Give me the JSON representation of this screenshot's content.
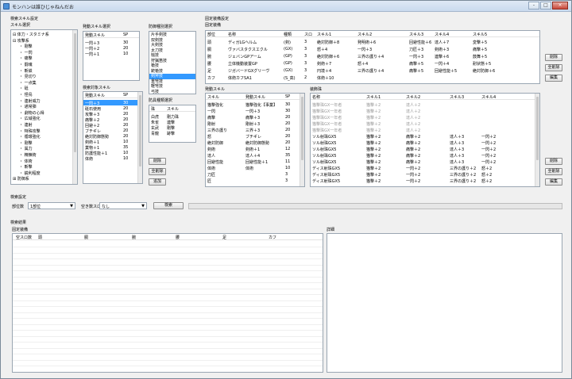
{
  "window": {
    "title": "モンハンは誰ひじゃねんだお",
    "min": "-",
    "max": "□",
    "close": "×"
  },
  "search": {
    "group_label": "検索スキル設定",
    "skill_select_label": "スキル選択",
    "tree": [
      "⊟ 体力・スタミナ系",
      "⊟ 攻撃系",
      "・ 剛撃",
      "・ 一閃",
      "・ 痛撃",
      "・ 闘魂",
      "・ 斬鉄",
      "・ 見切り",
      "・ 一点集",
      "・ 砥",
      "・ 怪鳥",
      "・ 連射威力",
      "・ 通常弾",
      "・ 劇物の心得",
      "・ 広域強化",
      "・ 連射",
      "・ 特殊攻撃",
      "・ 循環強化",
      "・ 剛撃",
      "・ 属力",
      "・ 精錬術",
      "・ 体術",
      "・ 斬撃",
      "・ 鋭利程度",
      "⊞ 防御系"
    ],
    "active_skill_label": "発動スキル選択",
    "active_skill_headers": [
      "発動スキル",
      "SP"
    ],
    "active_skills": [
      [
        "一閃＋3",
        "30"
      ],
      [
        "一閃＋2",
        "20"
      ],
      [
        "一閃＋1",
        "10"
      ]
    ],
    "target_label": "検索対象スキル",
    "target_headers": [
      "発動スキル",
      "SP"
    ],
    "targets": [
      [
        "一閃＋3",
        "30"
      ],
      [
        "砥石使用",
        "20"
      ],
      [
        "攻撃＋3",
        "20"
      ],
      [
        "痛撃＋2",
        "20"
      ],
      [
        "回避＋2",
        "20"
      ],
      [
        "ブチギレ",
        "20"
      ],
      [
        "絶対防御態勢",
        "20"
      ],
      [
        "剣術＋1",
        "10"
      ],
      [
        "業物＋1",
        "35"
      ],
      [
        "防護性能＋1",
        "10"
      ],
      [
        "体術",
        "10"
      ]
    ],
    "weapon_label": "防御種別選択",
    "weapons": [
      "片手剣技",
      "双剣技",
      "大剣技",
      "太刀技",
      "槌技",
      "狩猟笛技",
      "槍技",
      "銃槍技",
      "剣斧技",
      "重弩技",
      "軽弩技",
      "弓技"
    ],
    "weapon_selected": 8,
    "decor_label": "防具種類選択",
    "decor_headers": [
      "珠",
      "スキル"
    ],
    "decor_rows": [
      [
        "白虎",
        "剛力珠"
      ],
      [
        "朱雀",
        "連撃"
      ],
      [
        "玄武",
        "剛撃"
      ],
      [
        "青龍",
        "跡撃"
      ]
    ],
    "btn_delete": "削除",
    "btn_delete_all": "全削除",
    "btn_add": "追加"
  },
  "fixed": {
    "group_label": "固定装備設定",
    "equip_label": "固定装備",
    "headers": [
      "部位",
      "名称",
      "種類",
      "スロ",
      "スキル1",
      "スキル2",
      "スキル3",
      "スキル4",
      "スキル5"
    ],
    "rows": [
      [
        "頭",
        "ディガLGヘルム",
        "(剣)",
        "3",
        "絶対防御＋8",
        "発明術＋6",
        "回避性能＋6",
        "達人＋7",
        "変撃＋5"
      ],
      [
        "胴",
        "ヴァバスタクスエクル",
        "(GX)",
        "3",
        "怒＋4",
        "一閃＋3",
        "刀匠＋3",
        "剣術＋3",
        "痛撃＋5"
      ],
      [
        "腕",
        "ジェバンGPアーム",
        "(GP)",
        "3",
        "絶対防御＋6",
        "三界の護り＋4",
        "一閃＋3",
        "連撃＋6",
        "鼓舞＋5"
      ],
      [
        "腰",
        "立体機動装置GP",
        "(GP)",
        "3",
        "剣術＋7",
        "怒＋4",
        "痛撃＋5",
        "一閃＋4",
        "耐状態＋5"
      ],
      [
        "足",
        "ジガバードGXグリーヴ",
        "(GX)",
        "3",
        "円境＋4",
        "三界の護り＋4",
        "痛撃＋5",
        "回避性能＋5",
        "絶対防御＋6"
      ],
      [
        "カフ",
        "体術カフSA1",
        "(S_高)",
        "2",
        "体術＋10",
        "",
        "",
        "",
        ""
      ]
    ],
    "btn_delete": "削除",
    "btn_delete_all": "全削除",
    "btn_edit": "編集",
    "active_label": "発動スキル",
    "active_headers": [
      "スキル",
      "発動スキル",
      "SP"
    ],
    "active_rows": [
      [
        "猫撃強化",
        "猫撃強化【事業】",
        "30"
      ],
      [
        "一閃",
        "一閃＋3",
        "30"
      ],
      [
        "痛撃",
        "痛撃＋3",
        "20"
      ],
      [
        "剛射",
        "剛射＋3",
        "20"
      ],
      [
        "三界の護り",
        "三界＋3",
        "20"
      ],
      [
        "怒",
        "ブチギレ",
        "20"
      ],
      [
        "絶対防御",
        "絶対防御態勢",
        "20"
      ],
      [
        "剣術",
        "剣術＋1",
        "12"
      ],
      [
        "達人",
        "達人＋4",
        "35"
      ],
      [
        "回避性能",
        "回避性能＋1",
        "11"
      ],
      [
        "体術",
        "体術",
        "10"
      ],
      [
        "刀匠",
        "",
        "3"
      ],
      [
        "匠",
        "",
        "3"
      ]
    ],
    "decor_label": "装飾珠",
    "decor_headers": [
      "名称",
      "スキル1",
      "スキル2",
      "スキル3",
      "スキル4"
    ],
    "decor_rows": [
      [
        "猫撃珠GX一年者",
        "猫撃＋2",
        "達人＋2",
        "",
        ""
      ],
      [
        "猫撃珠GX一年者",
        "猫撃＋2",
        "達人＋2",
        "",
        ""
      ],
      [
        "猫撃珠GX一年者",
        "猫撃＋2",
        "達人＋2",
        "",
        ""
      ],
      [
        "猫撃珠GX一年者",
        "猫撃＋2",
        "達人＋2",
        "",
        ""
      ],
      [
        "猫撃珠GX一年者",
        "猫撃＋2",
        "達人＋2",
        "",
        ""
      ],
      [
        "ソル射珠GX5",
        "猫撃＋2",
        "痛撃＋2",
        "達人＋3",
        "一閃＋2"
      ],
      [
        "ソル射珠GX5",
        "猫撃＋2",
        "痛撃＋2",
        "達人＋3",
        "一閃＋2"
      ],
      [
        "ソル射珠GX5",
        "猫撃＋2",
        "痛撃＋2",
        "達人＋3",
        "一閃＋2"
      ],
      [
        "ソル射珠GX5",
        "猫撃＋2",
        "痛撃＋2",
        "達人＋3",
        "一閃＋2"
      ],
      [
        "ソル射珠GX5",
        "猫撃＋2",
        "痛撃＋2",
        "達人＋3",
        "一閃＋2"
      ],
      [
        "ディス射珠GX5",
        "猫撃＋2",
        "一閃＋2",
        "三界の護り＋2",
        "怒＋2"
      ],
      [
        "ディス射珠GX5",
        "猫撃＋2",
        "一閃＋2",
        "三界の護り＋2",
        "怒＋2"
      ],
      [
        "ディス射珠GX5",
        "猫撃＋2",
        "一閃＋2",
        "三界の護り＋2",
        "怒＋2"
      ]
    ],
    "decor_grey_rows": 5,
    "btn2_delete": "削除",
    "btn2_delete_all": "全削除",
    "btn2_edit": "編集"
  },
  "settings": {
    "group_label": "検索設定",
    "part_label": "部位数",
    "part_value": "1部位",
    "slot_label": "空き数スロ",
    "slot_value": "なし",
    "search_button": "検索",
    "progress": 0
  },
  "results": {
    "group_label": "検索結果",
    "list_label": "固定装備",
    "headers": [
      "空スロ数",
      "頭",
      "胴",
      "腕",
      "腰",
      "足",
      "カフ"
    ],
    "detail_label": "詳細"
  }
}
